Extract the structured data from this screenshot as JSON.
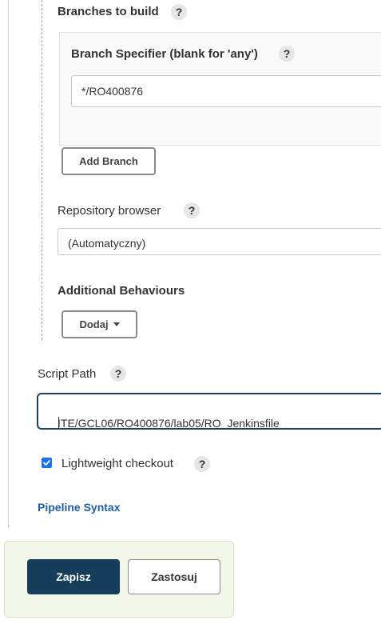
{
  "branches": {
    "title": "Branches to build",
    "help": "?",
    "specifier_label": "Branch Specifier (blank for 'any')",
    "specifier_help": "?",
    "specifier_value": "*/RO400876",
    "add_branch_label": "Add Branch"
  },
  "repository_browser": {
    "label": "Repository browser",
    "help": "?",
    "selected": "(Automatyczny)"
  },
  "additional_behaviours": {
    "label": "Additional Behaviours",
    "add_button_label": "Dodaj"
  },
  "script_path": {
    "label": "Script Path",
    "help": "?",
    "value": "ITE/GCL06/RO400876/lab05/RO_Jenkinsfile"
  },
  "lightweight": {
    "label": "Lightweight checkout",
    "help": "?",
    "checked": true
  },
  "pipeline_syntax_link": "Pipeline Syntax",
  "footer": {
    "save_label": "Zapisz",
    "apply_label": "Zastosuj"
  },
  "colors": {
    "primary": "#153e5b",
    "link": "#1f5ea8",
    "checkbox": "#1a73e8",
    "footer_bg": "#f3f7ea"
  }
}
